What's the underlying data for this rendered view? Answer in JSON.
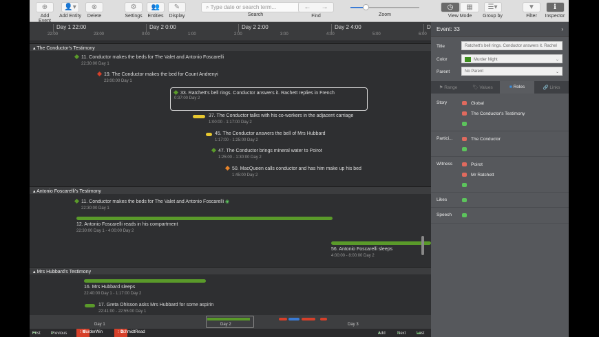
{
  "toolbar": {
    "add_event": "Add Event",
    "add_entity": "Add Entity",
    "delete": "Delete",
    "settings": "Settings",
    "entities": "Entities",
    "display": "Display",
    "search_placeholder": "Type date or search term...",
    "search": "Search",
    "find": "Find",
    "zoom": "Zoom",
    "zoom_level": 0.22,
    "view_mode": "View Mode",
    "group_by": "Group by",
    "filter": "Filter",
    "inspector": "Inspector"
  },
  "ruler": {
    "days": [
      "Day 1 22:00",
      "Day 2 0:00",
      "Day 2 2:00",
      "Day 2 4:00",
      "D"
    ],
    "hours": [
      "22:00",
      "23:00",
      "0:00",
      "1:00",
      "2:00",
      "3:00",
      "4:00",
      "5:00",
      "6:00"
    ]
  },
  "groups": [
    {
      "title": "The Conductor's Testimony",
      "events": [
        {
          "title": "11. Conductor makes the beds for The Valet and Antonio Foscarelli",
          "time": "22:30:00 Day 1"
        },
        {
          "title": "19. The Conductor makes the bed for Count Andrenyi",
          "time": "23:00:00 Day 1"
        },
        {
          "title": "33. Ratchett's bell rings. Conductor answers it. Rachett replies in French",
          "time": "0:37:00 Day 2"
        },
        {
          "title": "37. The Conductor talks with his co-workers in the adjacent carriage",
          "time": "1:00:00 - 1:17:00 Day 2"
        },
        {
          "title": "45. The Conductor answers the bell of Mrs Hubbard",
          "time": "1:17:00 - 1:25:00 Day 2"
        },
        {
          "title": "47. The Conductor brings mineral water to Poirot",
          "time": "1:25:00 - 1:30:00 Day 2"
        },
        {
          "title": "50. MacQueen calls conductor and has him make up his bed",
          "time": "1:45:00 Day 2"
        }
      ]
    },
    {
      "title": "Antonio Foscarelli's Testimony",
      "events": [
        {
          "title": "11. Conductor makes the beds for The Valet and Antonio Foscarelli",
          "time": "22:30:00 Day 1"
        },
        {
          "title": "12. Antonio Foscarelli reads in his compartment",
          "time": "22:30:00 Day 1 - 4:00:00 Day 2"
        },
        {
          "title": "56. Antonio Foscarelli sleeps",
          "time": "4:00:00 - 8:00:00 Day 2"
        }
      ]
    },
    {
      "title": "Mrs Hubbard's Testimony",
      "events": [
        {
          "title": "16. Mrs Hubbard sleeps",
          "time": "22:40:00 Day 1 - 1:17:00 Day 2"
        },
        {
          "title": "17. Greta Ohlsson asks Mrs Hubbard for some aspirin",
          "time": "22:41:00 - 22:55:00 Day 1"
        }
      ]
    }
  ],
  "minimap": {
    "days": [
      "Day 1",
      "Day 2",
      "Day 3"
    ]
  },
  "nav": {
    "first": "First",
    "previous": "Previous",
    "chips": [
      "MurderWin",
      "SchmidtRead"
    ],
    "add": "Add",
    "next": "Next",
    "last": "Last"
  },
  "inspector": {
    "header": "Event: 33",
    "title_label": "Title",
    "title_value": "Ratchett's bell rings. Conductor answers it. Rachel",
    "color_label": "Color",
    "color_value": "Murder Night",
    "color_hex": "#3f8f1f",
    "parent_label": "Parent",
    "parent_value": "No Parent",
    "tabs": [
      "Range",
      "Values",
      "Roles",
      "Links"
    ],
    "roles": {
      "story": "Story",
      "story_items": [
        "Global",
        "The Conductor's Testimony"
      ],
      "participant": "Partici...",
      "participant_items": [
        "The Conductor"
      ],
      "witness": "Witness",
      "witness_items": [
        "Poirot",
        "Mr Ratchett"
      ],
      "likes": "Likes",
      "speech": "Speech"
    }
  },
  "colors": {
    "green": "#5a9a2a",
    "red": "#d6402a",
    "yellow": "#e8c830",
    "orange": "#e8842a"
  }
}
